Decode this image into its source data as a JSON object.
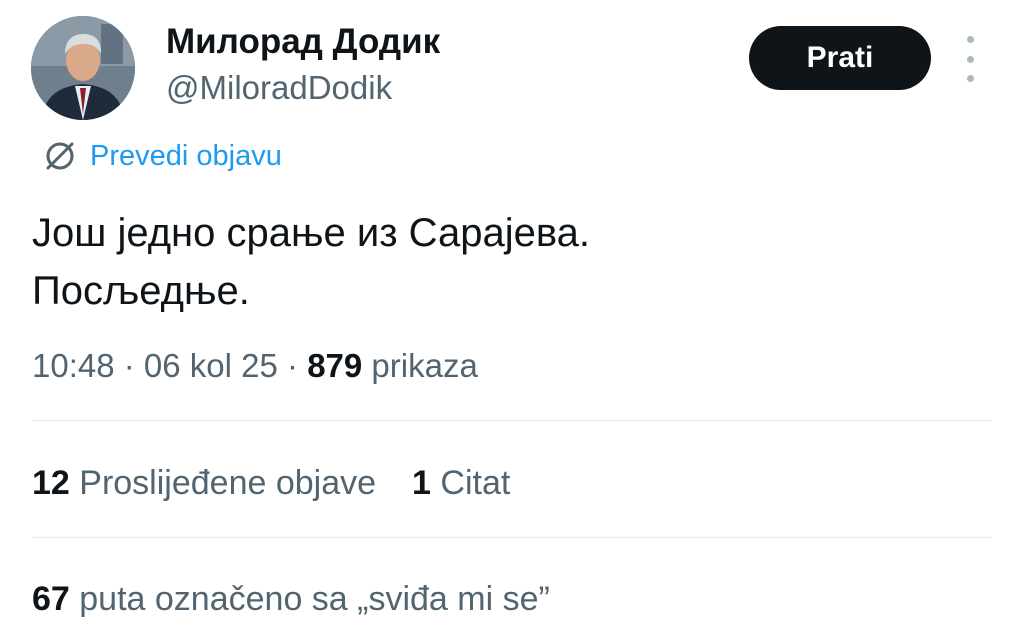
{
  "author": {
    "display_name": "Милорад Додик",
    "handle": "@MiloradDodik",
    "avatar": "profile-photo"
  },
  "actions": {
    "follow_label": "Prati",
    "more_icon": "vertical-ellipsis-icon"
  },
  "translate": {
    "icon": "globe-translate-icon",
    "label": "Prevedi objavu"
  },
  "tweet": {
    "lines": [
      "Још једно срање из Сарајева.",
      "Посљедње."
    ]
  },
  "meta": {
    "time": "10:48",
    "sep1": " · ",
    "date": "06 kol 25",
    "sep2": " · ",
    "views_count": "879",
    "views_label": " prikaza"
  },
  "stats": {
    "reposts_count": "12",
    "reposts_label": " Proslijeđene objave",
    "quotes_count": "1",
    "quotes_label": " Citat",
    "likes_count": "67",
    "likes_label": " puta označeno sa „sviđa mi se”"
  },
  "colors": {
    "text_primary": "#0f1419",
    "text_secondary": "#536471",
    "link": "#1d9bf0",
    "button_bg": "#0f1419",
    "divider": "#e6ecf0"
  }
}
